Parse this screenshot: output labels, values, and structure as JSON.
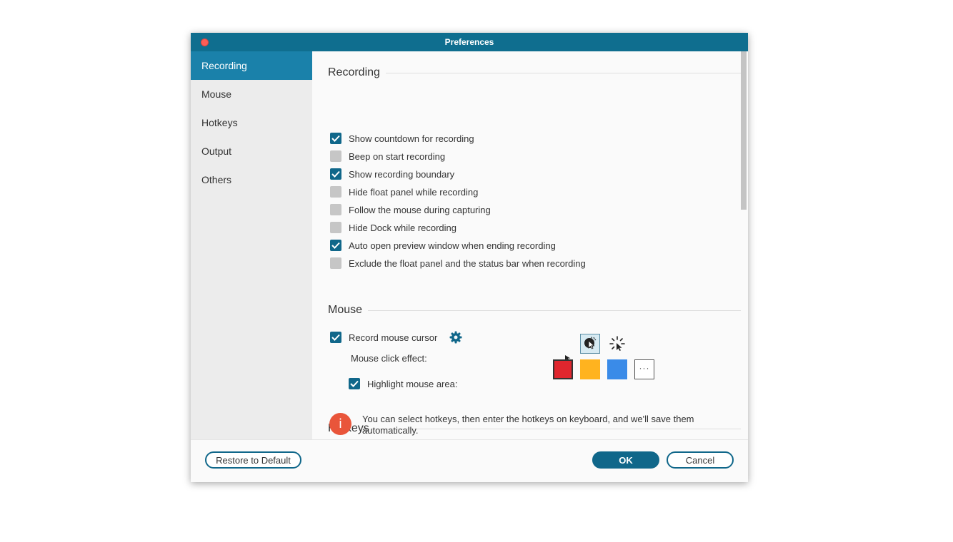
{
  "window": {
    "title": "Preferences"
  },
  "sidebar": {
    "items": [
      {
        "label": "Recording",
        "active": true
      },
      {
        "label": "Mouse",
        "active": false
      },
      {
        "label": "Hotkeys",
        "active": false
      },
      {
        "label": "Output",
        "active": false
      },
      {
        "label": "Others",
        "active": false
      }
    ]
  },
  "recording": {
    "title": "Recording",
    "options": [
      {
        "label": "Show countdown for recording",
        "checked": true
      },
      {
        "label": "Beep on start recording",
        "checked": false
      },
      {
        "label": "Show recording boundary",
        "checked": true
      },
      {
        "label": "Hide float panel while recording",
        "checked": false
      },
      {
        "label": "Follow the mouse during capturing",
        "checked": false
      },
      {
        "label": "Hide Dock while recording",
        "checked": false
      },
      {
        "label": "Auto open preview window when ending recording",
        "checked": true
      },
      {
        "label": "Exclude the float panel and the status bar when recording",
        "checked": false
      }
    ]
  },
  "mouse": {
    "title": "Mouse",
    "record_cursor": {
      "label": "Record mouse cursor",
      "checked": true
    },
    "click_effect_label": "Mouse click effect:",
    "click_effects": [
      "arrow-cursor-icon",
      "click-ripple-cursor-icon",
      "burst-cursor-icon"
    ],
    "selected_effect": "click-ripple-cursor-icon",
    "highlight": {
      "label": "Highlight mouse area:",
      "checked": true
    },
    "highlight_colors": [
      "#e0262e",
      "#ffb31f",
      "#3a8be8"
    ],
    "selected_color": "#e0262e"
  },
  "hotkeys": {
    "title": "Hotkeys",
    "info_glyph": "i",
    "info_text": "You can select hotkeys, then enter the hotkeys on keyboard, and we'll save them automatically."
  },
  "footer": {
    "restore_label": "Restore to Default",
    "ok_label": "OK",
    "cancel_label": "Cancel"
  },
  "colors": {
    "titlebar": "#0f6e8f",
    "sidebar_active": "#1a81aa",
    "checkbox_on": "#10678a",
    "info_icon": "#e9553a"
  }
}
